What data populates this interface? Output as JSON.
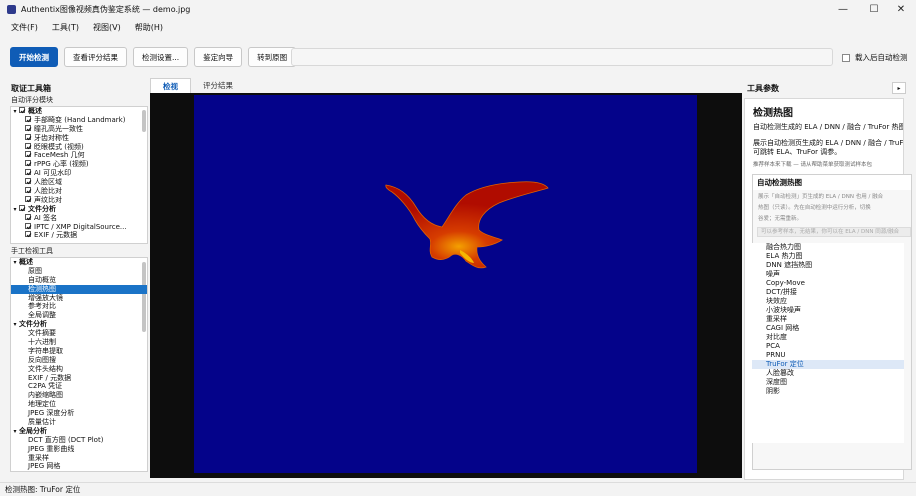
{
  "window": {
    "title": "Authentix图像视频真伪鉴定系统 — demo.jpg",
    "controls": {
      "minimize": "—",
      "maximize": "☐",
      "close": "✕"
    }
  },
  "menu": [
    "文件(F)",
    "工具(T)",
    "视图(V)",
    "帮助(H)"
  ],
  "toolbar": {
    "start": "开始检测",
    "view_results": "查看评分结果",
    "settings": "检测设置...",
    "wizard": "鉴定向导",
    "goto_original": "转到原图",
    "autoload_label": "载入后自动检测"
  },
  "left": {
    "title": "取证工具箱",
    "auto_title": "自动评分模块",
    "auto_tree": [
      {
        "label": "概述",
        "group": true
      },
      {
        "label": "手部畸变 (Hand Landmark)"
      },
      {
        "label": "瞳孔高光一致性"
      },
      {
        "label": "牙齿对称性"
      },
      {
        "label": "眨眼模式 (视频)"
      },
      {
        "label": "FaceMesh 几何"
      },
      {
        "label": "rPPG 心率 (视频)"
      },
      {
        "label": "AI 可见水印"
      },
      {
        "label": "人脸区域"
      },
      {
        "label": "人脸比对"
      },
      {
        "label": "声纹比对"
      },
      {
        "label": "文件分析",
        "group": true
      },
      {
        "label": "AI 签名"
      },
      {
        "label": "IPTC / XMP DigitalSource..."
      },
      {
        "label": "EXIF / 元数据"
      }
    ],
    "manual_title": "手工检视工具",
    "manual_tree": [
      {
        "label": "概述",
        "group": true
      },
      {
        "label": "原图"
      },
      {
        "label": "自动概览"
      },
      {
        "label": "检测热图",
        "selected": true
      },
      {
        "label": "增强放大镜"
      },
      {
        "label": "参考对比"
      },
      {
        "label": "全局调整"
      },
      {
        "label": "文件分析",
        "group": true
      },
      {
        "label": "文件摘要"
      },
      {
        "label": "十六进制"
      },
      {
        "label": "字符串提取"
      },
      {
        "label": "反向图搜"
      },
      {
        "label": "文件头结构"
      },
      {
        "label": "EXIF / 元数据"
      },
      {
        "label": "C2PA 凭证"
      },
      {
        "label": "内嵌缩略图"
      },
      {
        "label": "地理定位"
      },
      {
        "label": "JPEG 深度分析"
      },
      {
        "label": "质量估计"
      },
      {
        "label": "全局分析",
        "group": true
      },
      {
        "label": "DCT 直方图 (DCT Plot)"
      },
      {
        "label": "JPEG 重影曲线"
      },
      {
        "label": "重采样"
      },
      {
        "label": "JPEG 网格"
      }
    ]
  },
  "center": {
    "tabs": [
      "检视",
      "评分结果"
    ],
    "colors": {
      "background": "#04038a",
      "heat_outer": "#b50e00",
      "heat_inner": "#f08a00"
    }
  },
  "right": {
    "title": "工具参数",
    "collapse_icon": "▸",
    "heading": "检测热图",
    "desc": "自动检测生成的 ELA / DNN / 融合 / TruFor 热图",
    "detail_line1": "展示自动检测页生成的 ELA / DNN / 融合 / TruFor 热图",
    "detail_line2": "可跳转 ELA、TruFor 调参。",
    "hint": "推荐样本来下载 — 请从帮助菜单获取测试样本包",
    "group_title": "自动检测热图",
    "note_line1": "展示「自动检测」页生成的 ELA / DNN 也用 / 融合",
    "note_line2": "热图（只读）。先在自动检测中运行分析，切换",
    "note_line3": "谷爱；无需重新。",
    "input_placeholder": "可以参考样本，无结果，你可以在 ELA / DNN 同源/融合",
    "methods": [
      "融合热力图",
      "ELA 热力图",
      "DNN 遮挡热图",
      "噪声",
      "Copy-Move",
      "DCT/拼接",
      "块效应",
      "小波块噪声",
      "重采样",
      "CAGI 网格",
      "对比度",
      "PCA",
      "PRNU",
      "TruFor 定位",
      "人脸篡改",
      "深度图",
      "阴影"
    ],
    "selected_method": "TruFor 定位"
  },
  "status": "检测热图: TruFor 定位"
}
